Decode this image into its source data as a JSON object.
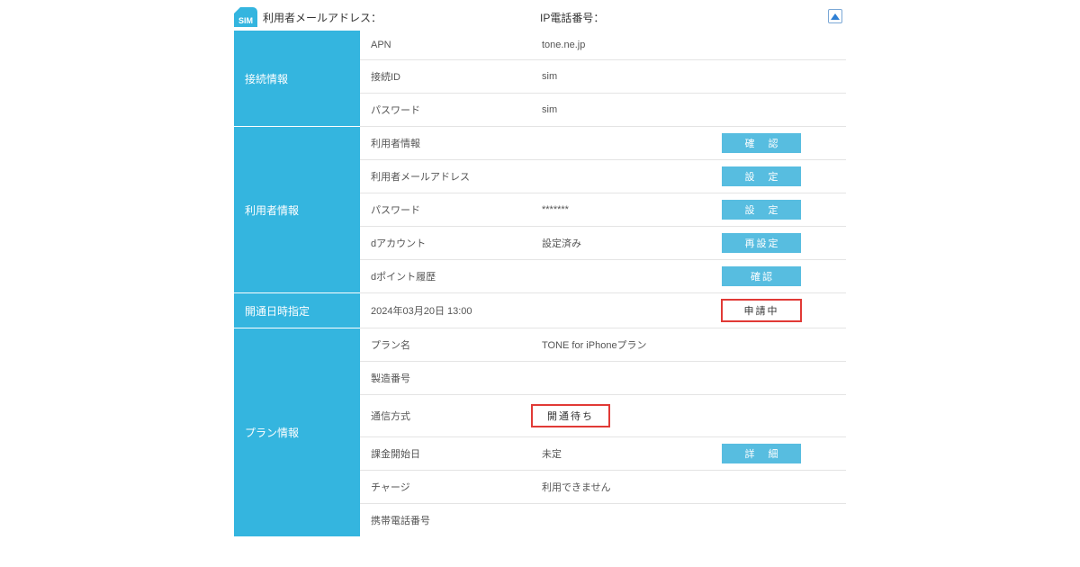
{
  "header": {
    "sim_badge": "SIM",
    "email_label": "利用者メールアドレス：",
    "ip_label": "IP電話番号："
  },
  "sections": {
    "connection": {
      "title": "接続情報",
      "apn_label": "APN",
      "apn_value": "tone.ne.jp",
      "id_label": "接続ID",
      "id_value": "sim",
      "pw_label": "パスワード",
      "pw_value": "sim"
    },
    "user": {
      "title": "利用者情報",
      "info_label": "利用者情報",
      "info_button": "確 認",
      "email_label": "利用者メールアドレス",
      "email_button": "設 定",
      "pw_label": "パスワード",
      "pw_value": "*******",
      "pw_button": "設 定",
      "daccount_label": "dアカウント",
      "daccount_value": "設定済み",
      "daccount_button": "再設定",
      "dpoint_label": "dポイント履歴",
      "dpoint_button": "確認"
    },
    "opening": {
      "title": "開通日時指定",
      "datetime": "2024年03月20日 13:00",
      "status": "申請中"
    },
    "plan": {
      "title": "プラン情報",
      "name_label": "プラン名",
      "name_value": "TONE for iPhoneプラン",
      "serial_label": "製造番号",
      "comm_label": "通信方式",
      "comm_status": "開通待ち",
      "billing_label": "課金開始日",
      "billing_value": "未定",
      "billing_button": "詳 細",
      "charge_label": "チャージ",
      "charge_value": "利用できません",
      "phone_label": "携帯電話番号"
    }
  }
}
